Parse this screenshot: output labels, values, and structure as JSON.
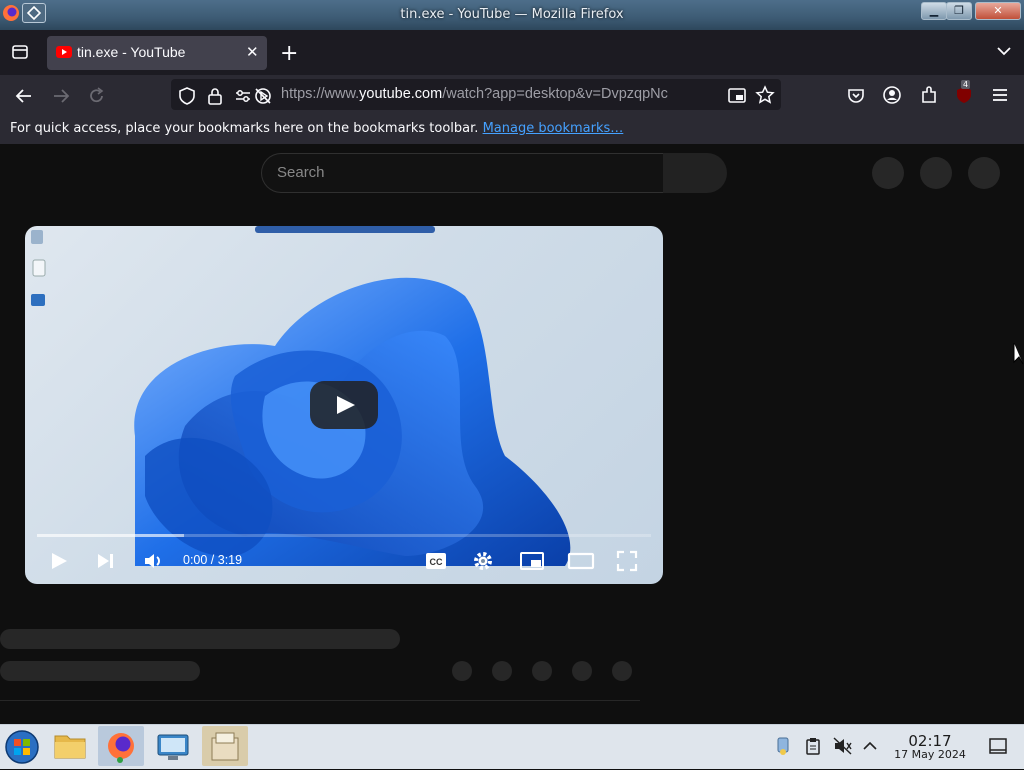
{
  "window": {
    "title": "tin.exe - YouTube — Mozilla Firefox",
    "buttons": [
      "minimize",
      "maximize",
      "close"
    ]
  },
  "tabs": [
    {
      "label": "tin.exe - YouTube",
      "icon": "youtube-icon",
      "active": true
    }
  ],
  "nav": {
    "url_prefix": "https://www.",
    "url_host": "youtube.com",
    "url_path": "/watch?app=desktop&v=DvpzqpNc",
    "extension_badge": "4"
  },
  "bookmarks_bar": {
    "message": "For quick access, place your bookmarks here on the bookmarks toolbar. ",
    "link": "Manage bookmarks…"
  },
  "youtube": {
    "search_placeholder": "Search",
    "player": {
      "time": "0:00 / 3:19",
      "progress_fraction": 0.0,
      "loaded_fraction": 0.24
    }
  },
  "taskbar": {
    "apps": [
      "start-button",
      "file-manager-icon",
      "firefox-icon",
      "remote-desktop-icon",
      "archive-icon"
    ],
    "clock_time": "02:17",
    "clock_date": "17 May 2024"
  },
  "colors": {
    "youtube_bg": "#0f0f0f",
    "firefox_toolbar": "#2b2a33",
    "link": "#45a1ff",
    "youtube_red": "#ff0000"
  }
}
